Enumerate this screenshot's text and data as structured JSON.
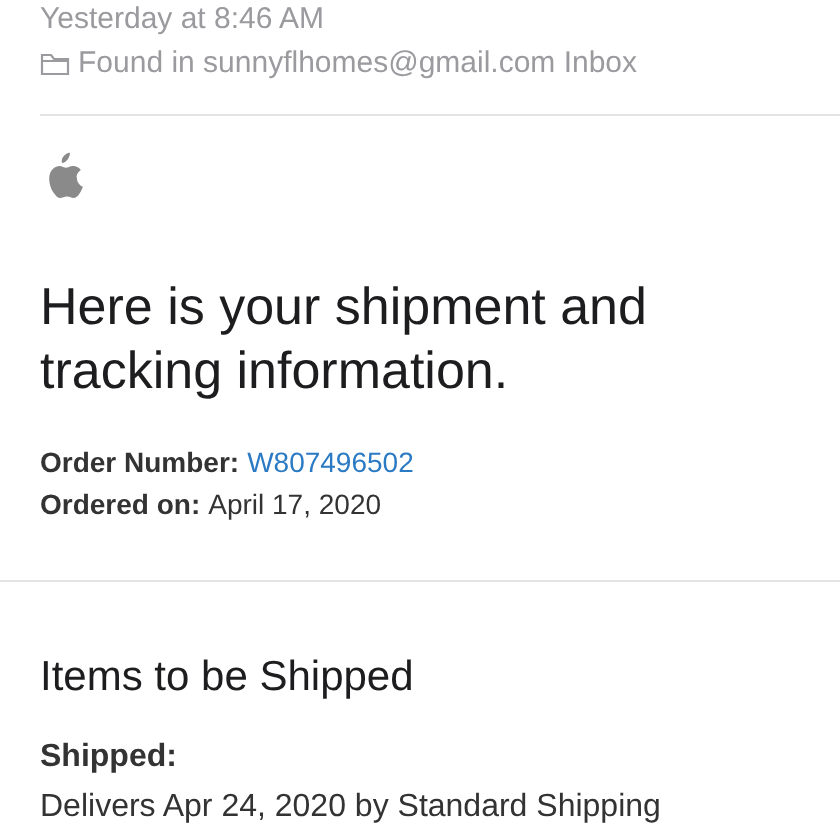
{
  "header": {
    "date": "Yesterday at 8:46 AM",
    "location": "Found in sunnyflhomes@gmail.com Inbox"
  },
  "email": {
    "heading": "Here is your shipment and tracking information.",
    "details": [
      {
        "kind": "link",
        "label": "Order Number:",
        "value": "W807496502"
      },
      {
        "kind": "text",
        "label": "Ordered on:",
        "value": "April 17, 2020"
      }
    ],
    "section_title": "Items to be Shipped",
    "status_label": "Shipped:",
    "delivery": "Delivers Apr 24, 2020 by Standard Shipping"
  }
}
